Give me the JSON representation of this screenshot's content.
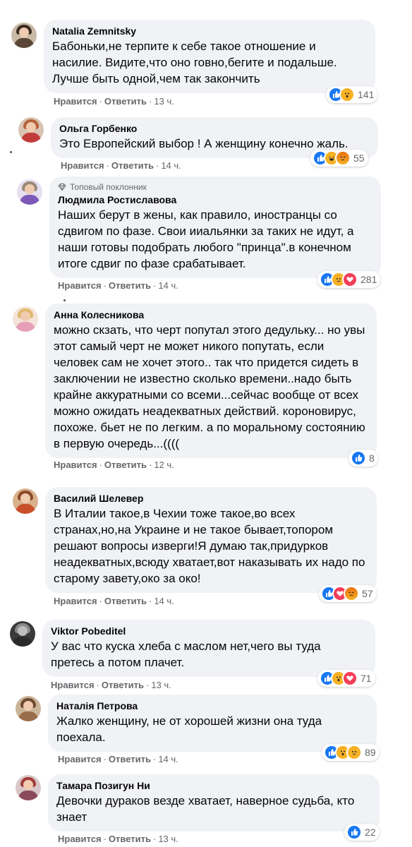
{
  "actions": {
    "like": "Нравится",
    "reply": "Ответить",
    "separator": "·"
  },
  "badge": {
    "top_fan": "Топовый поклонник"
  },
  "colors": {
    "bubble": "#f0f2f5",
    "like": "#1877f2",
    "love": "#f33e58",
    "emoji": "#f7b125",
    "meta_text": "#65676b"
  },
  "comments": [
    {
      "author": "Natalia Zemnitsky",
      "text": "Бабоньки,не терпите к себе такое отношение и насилие. Видите,что оно говно,бегите и подальше. Лучше быть одной,чем так закончить",
      "time": "13 ч.",
      "reactions": [
        "like",
        "wow"
      ],
      "count": "141"
    },
    {
      "author": "Ольга Горбенко",
      "text": "Это Европейский выбор ! А женщину конечно жаль.",
      "time": "14 ч.",
      "reactions": [
        "like",
        "haha",
        "angry"
      ],
      "count": "55"
    },
    {
      "author": "Людмила Ростиславова",
      "top_fan": true,
      "text": "Наших берут в жены, как правило, иностранцы со сдвигом по фазе. Свои ииальянки за таких не идут, а наши готовы подобрать любого \"принца\".в конечном итоге сдвиг по фазе срабатывает.",
      "time": "14 ч.",
      "reactions": [
        "like",
        "sad",
        "love"
      ],
      "count": "281"
    },
    {
      "author": "Анна Колесникова",
      "text": "можно скзать, что черт попутал этого дедульку... но увы этот самый черт не может никого попутать, если человек сам не хочет этого.. так что придется сидеть в заключении не известно сколько времени..надо быть крайне аккуратными со всеми...сейчас вообще от всех можно ожидать неадекватных действий. короновирус, похоже. бьет не по легким. а по моральному состоянию в первую очередь...((((",
      "time": "12 ч.",
      "reactions": [
        "like"
      ],
      "count": "8"
    },
    {
      "author": "Василий Шелевер",
      "text": "В Италии такое,в Чехии тоже такое,во всех странах,но,на Украине и не такое бывает,топором решают вопросы изверги!Я думаю так,придурков неадекватных,всюду хватает,вот наказывать их надо по старому завету,око за око!",
      "time": "14 ч.",
      "reactions": [
        "like",
        "love",
        "angry"
      ],
      "count": "57"
    },
    {
      "author": "Viktor Pobeditel",
      "text": "У вас что куска хлеба с маслом нет,чего вы туда претесь а потом плачет.",
      "time": "13 ч.",
      "reactions": [
        "like",
        "wow",
        "love"
      ],
      "count": "71"
    },
    {
      "author": "Наталія Петрова",
      "text": "Жалко женщину, не от хорошей жизни она туда поехала.",
      "time": "14 ч.",
      "reactions": [
        "like",
        "wow",
        "sad"
      ],
      "count": "89"
    },
    {
      "author": "Тамара Позигун Ни",
      "text": "Девочки дураков везде хватает, наверное судьба, кто знает",
      "time": "13 ч.",
      "reactions": [
        "like"
      ],
      "count": "22"
    }
  ]
}
